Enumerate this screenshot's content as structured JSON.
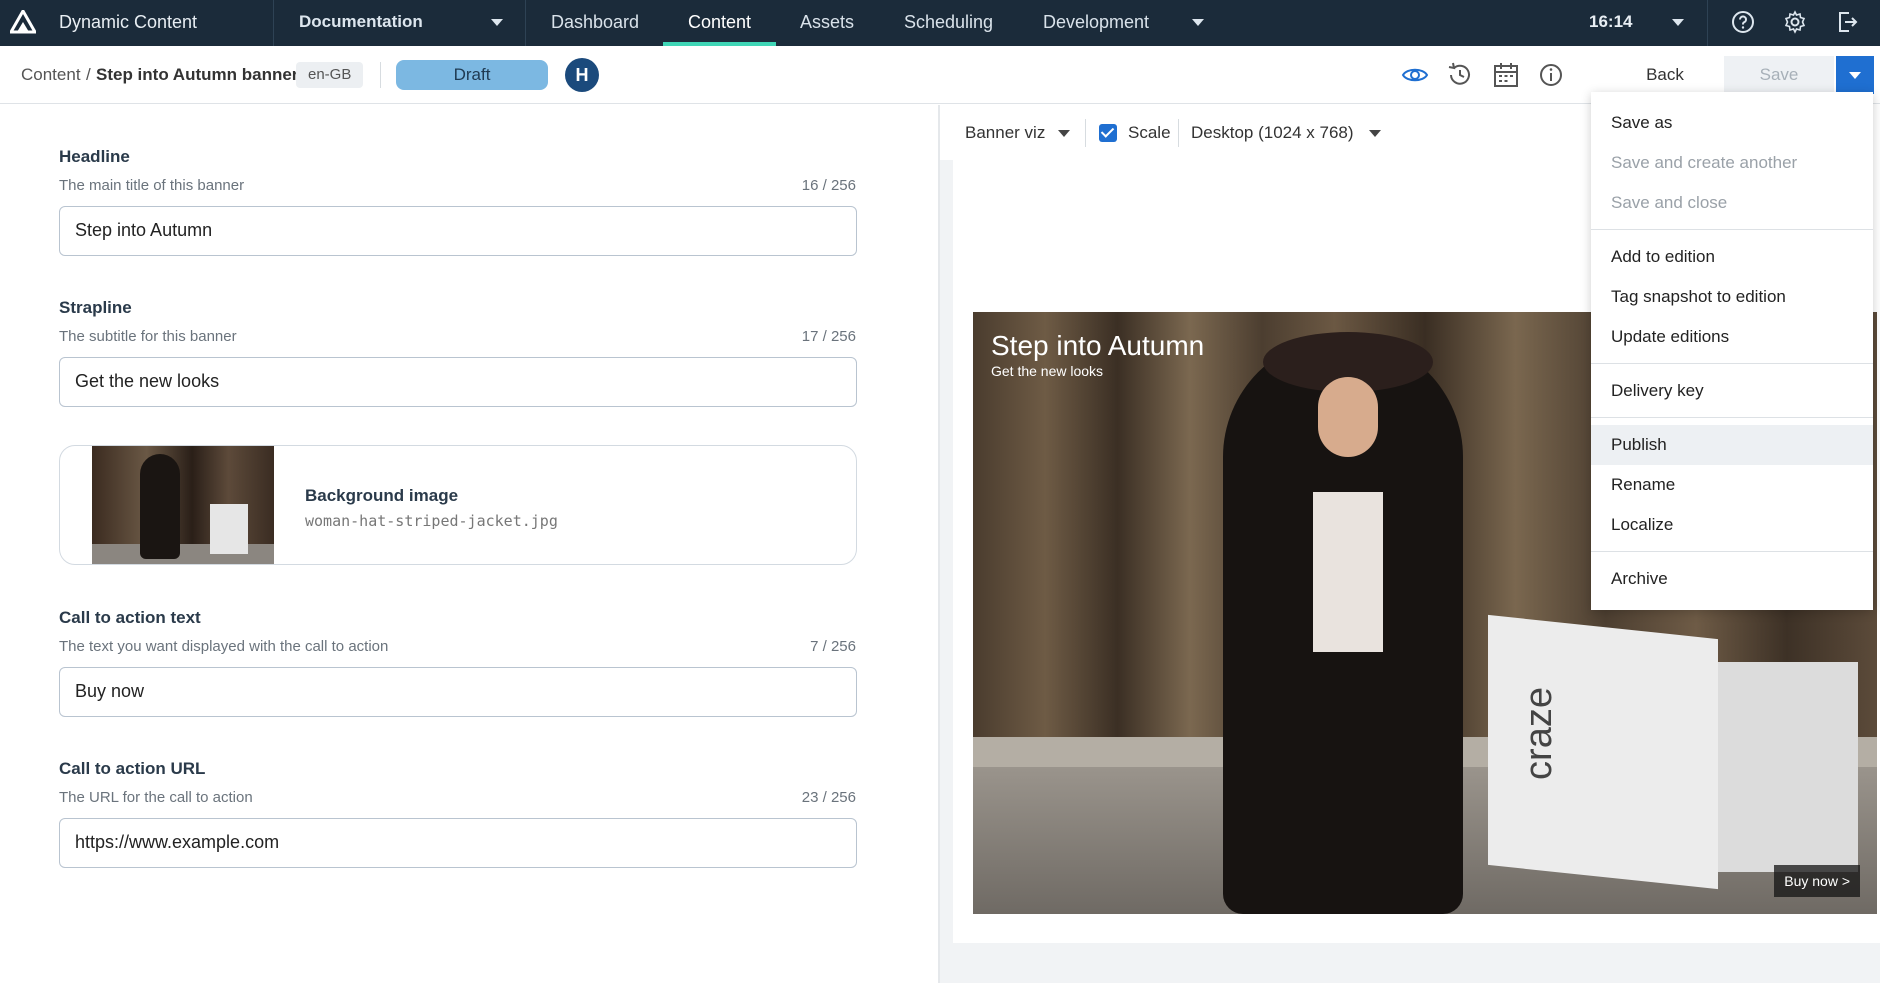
{
  "app": {
    "name": "Dynamic Content",
    "hub": "Documentation",
    "clock": "16:14"
  },
  "nav": {
    "tabs": [
      "Dashboard",
      "Content",
      "Assets",
      "Scheduling",
      "Development"
    ],
    "active": "Content"
  },
  "breadcrumb": {
    "root": "Content",
    "separator": "/",
    "current": "Step into Autumn banner"
  },
  "locale": "en-GB",
  "status": "Draft",
  "avatar_initial": "H",
  "toolbar": {
    "back": "Back",
    "save": "Save"
  },
  "fields": [
    {
      "title": "Headline",
      "desc": "The main title of this banner",
      "count": "16 / 256",
      "value": "Step into Autumn"
    },
    {
      "title": "Strapline",
      "desc": "The subtitle for this banner",
      "count": "17 / 256",
      "value": "Get the new looks"
    },
    {
      "title": "Call to action text",
      "desc": "The text you want displayed with the call to action",
      "count": "7 / 256",
      "value": "Buy now"
    },
    {
      "title": "Call to action URL",
      "desc": "The URL for the call to action",
      "count": "23 / 256",
      "value": "https://www.example.com"
    }
  ],
  "image_field": {
    "title": "Background image",
    "file": "woman-hat-striped-jacket.jpg"
  },
  "preview": {
    "viz": "Banner viz",
    "scale_label": "Scale",
    "scale_checked": true,
    "device": "Desktop (1024 x 768)",
    "banner": {
      "title": "Step into Autumn",
      "subtitle": "Get the new looks",
      "cta": "Buy now >",
      "bag_text": "craze"
    }
  },
  "menu": {
    "group1": [
      "Save as",
      "Save and create another",
      "Save and close"
    ],
    "group2": [
      "Add to edition",
      "Tag snapshot to edition",
      "Update editions"
    ],
    "group3": [
      "Delivery key"
    ],
    "group4": [
      "Publish",
      "Rename",
      "Localize"
    ],
    "group5": [
      "Archive"
    ]
  },
  "colors": {
    "topbar": "#1b2b3a",
    "active_tab_accent": "#3fd6b6",
    "draft_badge": "#7cb8e2",
    "primary": "#1f6fd1"
  }
}
